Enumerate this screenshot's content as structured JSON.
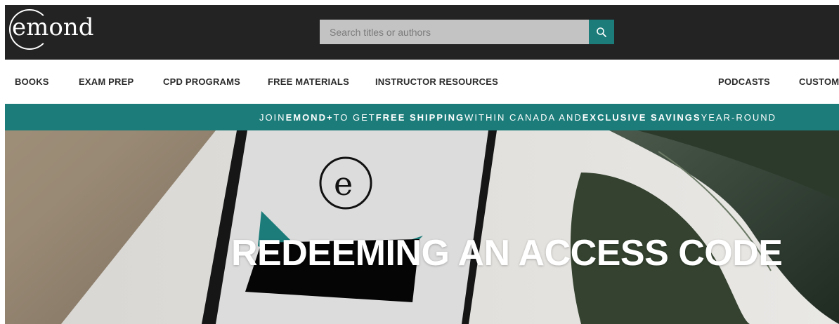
{
  "header": {
    "logo_text": "emond",
    "search": {
      "placeholder": "Search titles or authors",
      "value": ""
    }
  },
  "nav": {
    "items": [
      {
        "label": "BOOKS"
      },
      {
        "label": "EXAM PREP"
      },
      {
        "label": "CPD PROGRAMS"
      },
      {
        "label": "FREE MATERIALS"
      },
      {
        "label": "INSTRUCTOR RESOURCES"
      },
      {
        "label": "PODCASTS"
      },
      {
        "label": "CUSTOM"
      }
    ]
  },
  "promo": {
    "part1": "JOIN ",
    "part2": "EMOND+",
    "part3": " TO GET ",
    "part4": "FREE SHIPPING",
    "part5": " WITHIN CANADA AND ",
    "part6": "EXCLUSIVE SAVINGS",
    "part7": " YEAR-ROUND"
  },
  "hero": {
    "title": "REDEEMING AN ACCESS CODE",
    "phone_logo": "e"
  },
  "colors": {
    "header_bg": "#232323",
    "accent_teal": "#1b7c7a",
    "search_bg": "#c3c3c3"
  },
  "icons": {
    "search_button": "search-icon"
  }
}
